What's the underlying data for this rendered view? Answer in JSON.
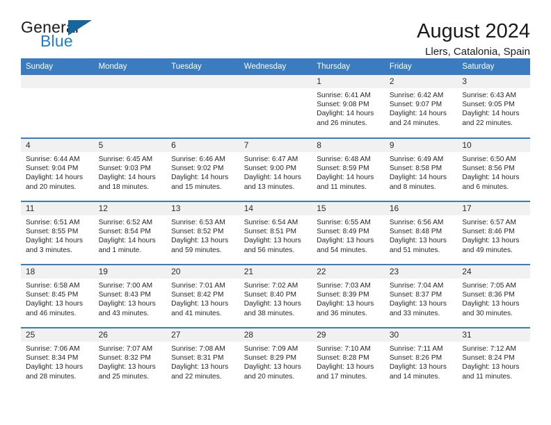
{
  "brand": {
    "name_part1": "General",
    "name_part2": "Blue",
    "triangle_color": "#15659f",
    "blue_color": "#1b7fd4"
  },
  "header": {
    "title": "August 2024",
    "location": "Llers, Catalonia, Spain"
  },
  "theme": {
    "header_blue": "#3b7cc1",
    "daynum_bg": "#f1f1f1",
    "text": "#262626"
  },
  "weekday_headers": [
    "Sunday",
    "Monday",
    "Tuesday",
    "Wednesday",
    "Thursday",
    "Friday",
    "Saturday"
  ],
  "labels": {
    "sunrise_prefix": "Sunrise:",
    "sunset_prefix": "Sunset:",
    "daylight_prefix": "Daylight:"
  },
  "weeks": [
    [
      {
        "day": "",
        "empty": true,
        "sunrise": "",
        "sunset": "",
        "daylight_1": "",
        "daylight_2": ""
      },
      {
        "day": "",
        "empty": true,
        "sunrise": "",
        "sunset": "",
        "daylight_1": "",
        "daylight_2": ""
      },
      {
        "day": "",
        "empty": true,
        "sunrise": "",
        "sunset": "",
        "daylight_1": "",
        "daylight_2": ""
      },
      {
        "day": "",
        "empty": true,
        "sunrise": "",
        "sunset": "",
        "daylight_1": "",
        "daylight_2": ""
      },
      {
        "day": "1",
        "empty": false,
        "sunrise": "Sunrise: 6:41 AM",
        "sunset": "Sunset: 9:08 PM",
        "daylight_1": "Daylight: 14 hours",
        "daylight_2": "and 26 minutes."
      },
      {
        "day": "2",
        "empty": false,
        "sunrise": "Sunrise: 6:42 AM",
        "sunset": "Sunset: 9:07 PM",
        "daylight_1": "Daylight: 14 hours",
        "daylight_2": "and 24 minutes."
      },
      {
        "day": "3",
        "empty": false,
        "sunrise": "Sunrise: 6:43 AM",
        "sunset": "Sunset: 9:05 PM",
        "daylight_1": "Daylight: 14 hours",
        "daylight_2": "and 22 minutes."
      }
    ],
    [
      {
        "day": "4",
        "empty": false,
        "sunrise": "Sunrise: 6:44 AM",
        "sunset": "Sunset: 9:04 PM",
        "daylight_1": "Daylight: 14 hours",
        "daylight_2": "and 20 minutes."
      },
      {
        "day": "5",
        "empty": false,
        "sunrise": "Sunrise: 6:45 AM",
        "sunset": "Sunset: 9:03 PM",
        "daylight_1": "Daylight: 14 hours",
        "daylight_2": "and 18 minutes."
      },
      {
        "day": "6",
        "empty": false,
        "sunrise": "Sunrise: 6:46 AM",
        "sunset": "Sunset: 9:02 PM",
        "daylight_1": "Daylight: 14 hours",
        "daylight_2": "and 15 minutes."
      },
      {
        "day": "7",
        "empty": false,
        "sunrise": "Sunrise: 6:47 AM",
        "sunset": "Sunset: 9:00 PM",
        "daylight_1": "Daylight: 14 hours",
        "daylight_2": "and 13 minutes."
      },
      {
        "day": "8",
        "empty": false,
        "sunrise": "Sunrise: 6:48 AM",
        "sunset": "Sunset: 8:59 PM",
        "daylight_1": "Daylight: 14 hours",
        "daylight_2": "and 11 minutes."
      },
      {
        "day": "9",
        "empty": false,
        "sunrise": "Sunrise: 6:49 AM",
        "sunset": "Sunset: 8:58 PM",
        "daylight_1": "Daylight: 14 hours",
        "daylight_2": "and 8 minutes."
      },
      {
        "day": "10",
        "empty": false,
        "sunrise": "Sunrise: 6:50 AM",
        "sunset": "Sunset: 8:56 PM",
        "daylight_1": "Daylight: 14 hours",
        "daylight_2": "and 6 minutes."
      }
    ],
    [
      {
        "day": "11",
        "empty": false,
        "sunrise": "Sunrise: 6:51 AM",
        "sunset": "Sunset: 8:55 PM",
        "daylight_1": "Daylight: 14 hours",
        "daylight_2": "and 3 minutes."
      },
      {
        "day": "12",
        "empty": false,
        "sunrise": "Sunrise: 6:52 AM",
        "sunset": "Sunset: 8:54 PM",
        "daylight_1": "Daylight: 14 hours",
        "daylight_2": "and 1 minute."
      },
      {
        "day": "13",
        "empty": false,
        "sunrise": "Sunrise: 6:53 AM",
        "sunset": "Sunset: 8:52 PM",
        "daylight_1": "Daylight: 13 hours",
        "daylight_2": "and 59 minutes."
      },
      {
        "day": "14",
        "empty": false,
        "sunrise": "Sunrise: 6:54 AM",
        "sunset": "Sunset: 8:51 PM",
        "daylight_1": "Daylight: 13 hours",
        "daylight_2": "and 56 minutes."
      },
      {
        "day": "15",
        "empty": false,
        "sunrise": "Sunrise: 6:55 AM",
        "sunset": "Sunset: 8:49 PM",
        "daylight_1": "Daylight: 13 hours",
        "daylight_2": "and 54 minutes."
      },
      {
        "day": "16",
        "empty": false,
        "sunrise": "Sunrise: 6:56 AM",
        "sunset": "Sunset: 8:48 PM",
        "daylight_1": "Daylight: 13 hours",
        "daylight_2": "and 51 minutes."
      },
      {
        "day": "17",
        "empty": false,
        "sunrise": "Sunrise: 6:57 AM",
        "sunset": "Sunset: 8:46 PM",
        "daylight_1": "Daylight: 13 hours",
        "daylight_2": "and 49 minutes."
      }
    ],
    [
      {
        "day": "18",
        "empty": false,
        "sunrise": "Sunrise: 6:58 AM",
        "sunset": "Sunset: 8:45 PM",
        "daylight_1": "Daylight: 13 hours",
        "daylight_2": "and 46 minutes."
      },
      {
        "day": "19",
        "empty": false,
        "sunrise": "Sunrise: 7:00 AM",
        "sunset": "Sunset: 8:43 PM",
        "daylight_1": "Daylight: 13 hours",
        "daylight_2": "and 43 minutes."
      },
      {
        "day": "20",
        "empty": false,
        "sunrise": "Sunrise: 7:01 AM",
        "sunset": "Sunset: 8:42 PM",
        "daylight_1": "Daylight: 13 hours",
        "daylight_2": "and 41 minutes."
      },
      {
        "day": "21",
        "empty": false,
        "sunrise": "Sunrise: 7:02 AM",
        "sunset": "Sunset: 8:40 PM",
        "daylight_1": "Daylight: 13 hours",
        "daylight_2": "and 38 minutes."
      },
      {
        "day": "22",
        "empty": false,
        "sunrise": "Sunrise: 7:03 AM",
        "sunset": "Sunset: 8:39 PM",
        "daylight_1": "Daylight: 13 hours",
        "daylight_2": "and 36 minutes."
      },
      {
        "day": "23",
        "empty": false,
        "sunrise": "Sunrise: 7:04 AM",
        "sunset": "Sunset: 8:37 PM",
        "daylight_1": "Daylight: 13 hours",
        "daylight_2": "and 33 minutes."
      },
      {
        "day": "24",
        "empty": false,
        "sunrise": "Sunrise: 7:05 AM",
        "sunset": "Sunset: 8:36 PM",
        "daylight_1": "Daylight: 13 hours",
        "daylight_2": "and 30 minutes."
      }
    ],
    [
      {
        "day": "25",
        "empty": false,
        "sunrise": "Sunrise: 7:06 AM",
        "sunset": "Sunset: 8:34 PM",
        "daylight_1": "Daylight: 13 hours",
        "daylight_2": "and 28 minutes."
      },
      {
        "day": "26",
        "empty": false,
        "sunrise": "Sunrise: 7:07 AM",
        "sunset": "Sunset: 8:32 PM",
        "daylight_1": "Daylight: 13 hours",
        "daylight_2": "and 25 minutes."
      },
      {
        "day": "27",
        "empty": false,
        "sunrise": "Sunrise: 7:08 AM",
        "sunset": "Sunset: 8:31 PM",
        "daylight_1": "Daylight: 13 hours",
        "daylight_2": "and 22 minutes."
      },
      {
        "day": "28",
        "empty": false,
        "sunrise": "Sunrise: 7:09 AM",
        "sunset": "Sunset: 8:29 PM",
        "daylight_1": "Daylight: 13 hours",
        "daylight_2": "and 20 minutes."
      },
      {
        "day": "29",
        "empty": false,
        "sunrise": "Sunrise: 7:10 AM",
        "sunset": "Sunset: 8:28 PM",
        "daylight_1": "Daylight: 13 hours",
        "daylight_2": "and 17 minutes."
      },
      {
        "day": "30",
        "empty": false,
        "sunrise": "Sunrise: 7:11 AM",
        "sunset": "Sunset: 8:26 PM",
        "daylight_1": "Daylight: 13 hours",
        "daylight_2": "and 14 minutes."
      },
      {
        "day": "31",
        "empty": false,
        "sunrise": "Sunrise: 7:12 AM",
        "sunset": "Sunset: 8:24 PM",
        "daylight_1": "Daylight: 13 hours",
        "daylight_2": "and 11 minutes."
      }
    ]
  ]
}
